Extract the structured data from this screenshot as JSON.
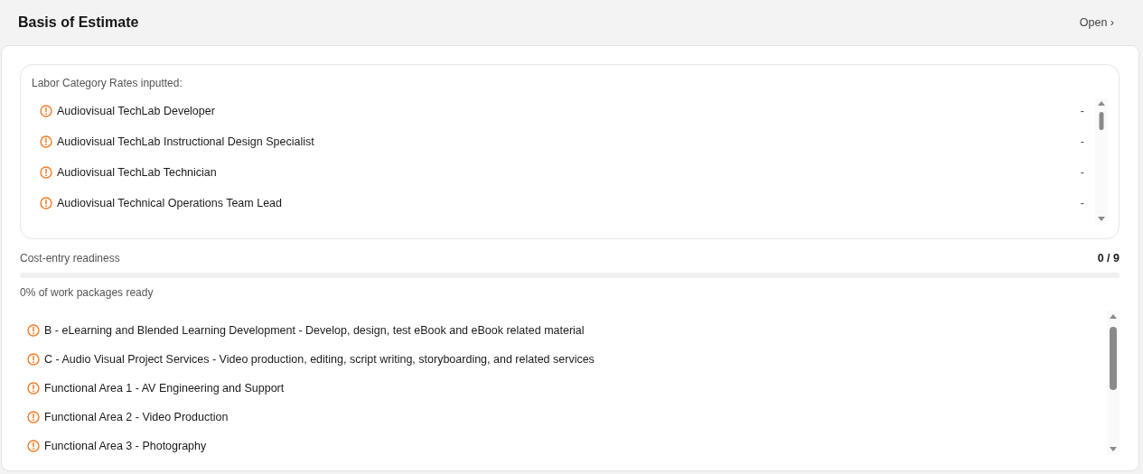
{
  "header": {
    "title": "Basis of Estimate",
    "open_link": "Open ›"
  },
  "labor_rates": {
    "label": "Labor Category Rates inputted:",
    "items": [
      {
        "name": "Audiovisual TechLab Developer",
        "value": "-"
      },
      {
        "name": "Audiovisual TechLab Instructional Design Specialist",
        "value": "-"
      },
      {
        "name": "Audiovisual TechLab Technician",
        "value": "-"
      },
      {
        "name": "Audiovisual Technical Operations Team Lead",
        "value": "-"
      }
    ]
  },
  "readiness": {
    "label": "Cost-entry readiness",
    "count": "0 / 9",
    "level": 0,
    "caption": "0% of work packages ready"
  },
  "work_packages": [
    {
      "name": "B - eLearning and Blended Learning Development - Develop, design, test eBook and eBook related material"
    },
    {
      "name": "C - Audio Visual Project Services - Video production, editing, script writing, storyboarding, and related services"
    },
    {
      "name": "Functional Area 1 - AV Engineering and Support"
    },
    {
      "name": "Functional Area 2 - Video Production"
    },
    {
      "name": "Functional Area 3 - Photography"
    }
  ]
}
